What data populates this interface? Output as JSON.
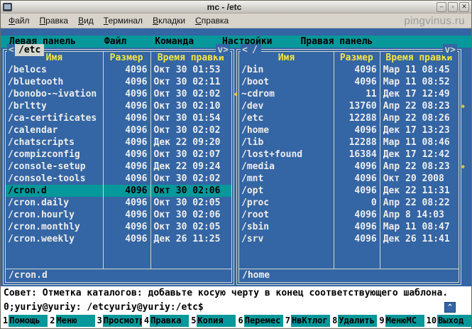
{
  "window": {
    "title": "mc - /etc",
    "watermark": "pingvinus.ru",
    "buttons": {
      "minimize": "–",
      "maximize": "▫",
      "close": "✕"
    }
  },
  "colors": {
    "panel_bg": "#3465a4",
    "teal": "#06989a",
    "header_yellow": "#f5e642",
    "frame": "#d3d7cf"
  },
  "menubar": {
    "items": [
      "Файл",
      "Правка",
      "Вид",
      "Терминал",
      "Вкладки",
      "Справка"
    ]
  },
  "mc": {
    "menu": [
      "Левая панель",
      "Файл",
      "Команда",
      "Настройки",
      "Правая панель"
    ],
    "panel_glyphs": {
      "prev": "<",
      "dropdown": "v>"
    },
    "hint": "Совет: Отметка каталогов: добавьте косую черту в конец соответствующего шаблона.",
    "prompt": "0;yuriy@yuriy: /etcyuriy@yuriy:/etc$",
    "scroll_up_glyph": "^",
    "fkeys": [
      {
        "num": "1",
        "label": "Помощь"
      },
      {
        "num": "2",
        "label": "Меню"
      },
      {
        "num": "3",
        "label": "Просмотр"
      },
      {
        "num": "4",
        "label": "Правка"
      },
      {
        "num": "5",
        "label": "Копия"
      },
      {
        "num": "6",
        "label": "Перемес"
      },
      {
        "num": "7",
        "label": "НвКтлог"
      },
      {
        "num": "8",
        "label": "Удалить"
      },
      {
        "num": "9",
        "label": "МенюМС"
      },
      {
        "num": "10",
        "label": "Выход"
      }
    ]
  },
  "left_panel": {
    "path": "/etc",
    "active": true,
    "columns": [
      "Имя",
      "Размер",
      "Время правки"
    ],
    "status": "/cron.d",
    "selected_index": 10,
    "markers": [
      2
    ],
    "rows": [
      {
        "name": "/belocs",
        "size": "4096",
        "mtime": "Окт 30 01:53"
      },
      {
        "name": "/bluetooth",
        "size": "4096",
        "mtime": "Окт 30 02:11"
      },
      {
        "name": "/bonobo-~ivation",
        "size": "4096",
        "mtime": "Окт 30 02:02"
      },
      {
        "name": "/brltty",
        "size": "4096",
        "mtime": "Окт 30 02:10"
      },
      {
        "name": "/ca-certificates",
        "size": "4096",
        "mtime": "Окт 30 01:54"
      },
      {
        "name": "/calendar",
        "size": "4096",
        "mtime": "Окт 30 02:02"
      },
      {
        "name": "/chatscripts",
        "size": "4096",
        "mtime": "Дек 22 09:20"
      },
      {
        "name": "/compizconfig",
        "size": "4096",
        "mtime": "Окт 30 02:07"
      },
      {
        "name": "/console-setup",
        "size": "4096",
        "mtime": "Дек 22 09:24"
      },
      {
        "name": "/console-tools",
        "size": "4096",
        "mtime": "Окт 30 02:02"
      },
      {
        "name": "/cron.d",
        "size": "4096",
        "mtime": "Окт 30 02:06"
      },
      {
        "name": "/cron.daily",
        "size": "4096",
        "mtime": "Окт 30 02:05"
      },
      {
        "name": "/cron.hourly",
        "size": "4096",
        "mtime": "Окт 30 02:06"
      },
      {
        "name": "/cron.monthly",
        "size": "4096",
        "mtime": "Окт 30 02:05"
      },
      {
        "name": "/cron.weekly",
        "size": "4096",
        "mtime": "Дек 26 11:25"
      }
    ]
  },
  "right_panel": {
    "path": "/",
    "active": false,
    "columns": [
      "Имя",
      "Размер",
      "Время правки"
    ],
    "status": "/home",
    "selected_index": -1,
    "markers": [
      3,
      8
    ],
    "rows": [
      {
        "name": "/bin",
        "size": "4096",
        "mtime": "Мар 11 08:45"
      },
      {
        "name": "/boot",
        "size": "4096",
        "mtime": "Мар 11 08:52"
      },
      {
        "name": "~cdrom",
        "size": "11",
        "mtime": "Дек 17 12:49"
      },
      {
        "name": "/dev",
        "size": "13760",
        "mtime": "Апр 22 08:23"
      },
      {
        "name": "/etc",
        "size": "12288",
        "mtime": "Апр 22 08:26"
      },
      {
        "name": "/home",
        "size": "4096",
        "mtime": "Дек 17 13:23"
      },
      {
        "name": "/lib",
        "size": "12288",
        "mtime": "Мар 11 08:46"
      },
      {
        "name": "/lost+found",
        "size": "16384",
        "mtime": "Дек 17 12:42"
      },
      {
        "name": "/media",
        "size": "4096",
        "mtime": "Апр 22 08:23"
      },
      {
        "name": "/mnt",
        "size": "4096",
        "mtime": "Окт 20  2008"
      },
      {
        "name": "/opt",
        "size": "4096",
        "mtime": "Дек 22 11:31"
      },
      {
        "name": "/proc",
        "size": "0",
        "mtime": "Апр 22 08:22"
      },
      {
        "name": "/root",
        "size": "4096",
        "mtime": "Апр  8 14:03"
      },
      {
        "name": "/sbin",
        "size": "4096",
        "mtime": "Мар 11 08:47"
      },
      {
        "name": "/srv",
        "size": "4096",
        "mtime": "Дек 26 11:41"
      }
    ]
  }
}
